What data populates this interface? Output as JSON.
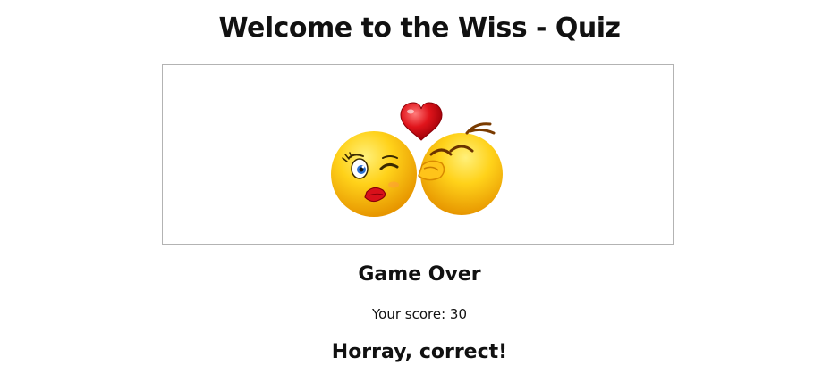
{
  "header": {
    "title": "Welcome to the Wiss - Quiz"
  },
  "quiz_image": {
    "icon": "kissing-emoji-couple-icon",
    "colors": {
      "face": "#f5b800",
      "face_highlight": "#ffe25a",
      "heart": "#e0141b",
      "lips": "#d8101a"
    }
  },
  "result": {
    "status_heading": "Game Over",
    "score_label": "Your score: 30",
    "feedback": "Horray, correct!"
  }
}
